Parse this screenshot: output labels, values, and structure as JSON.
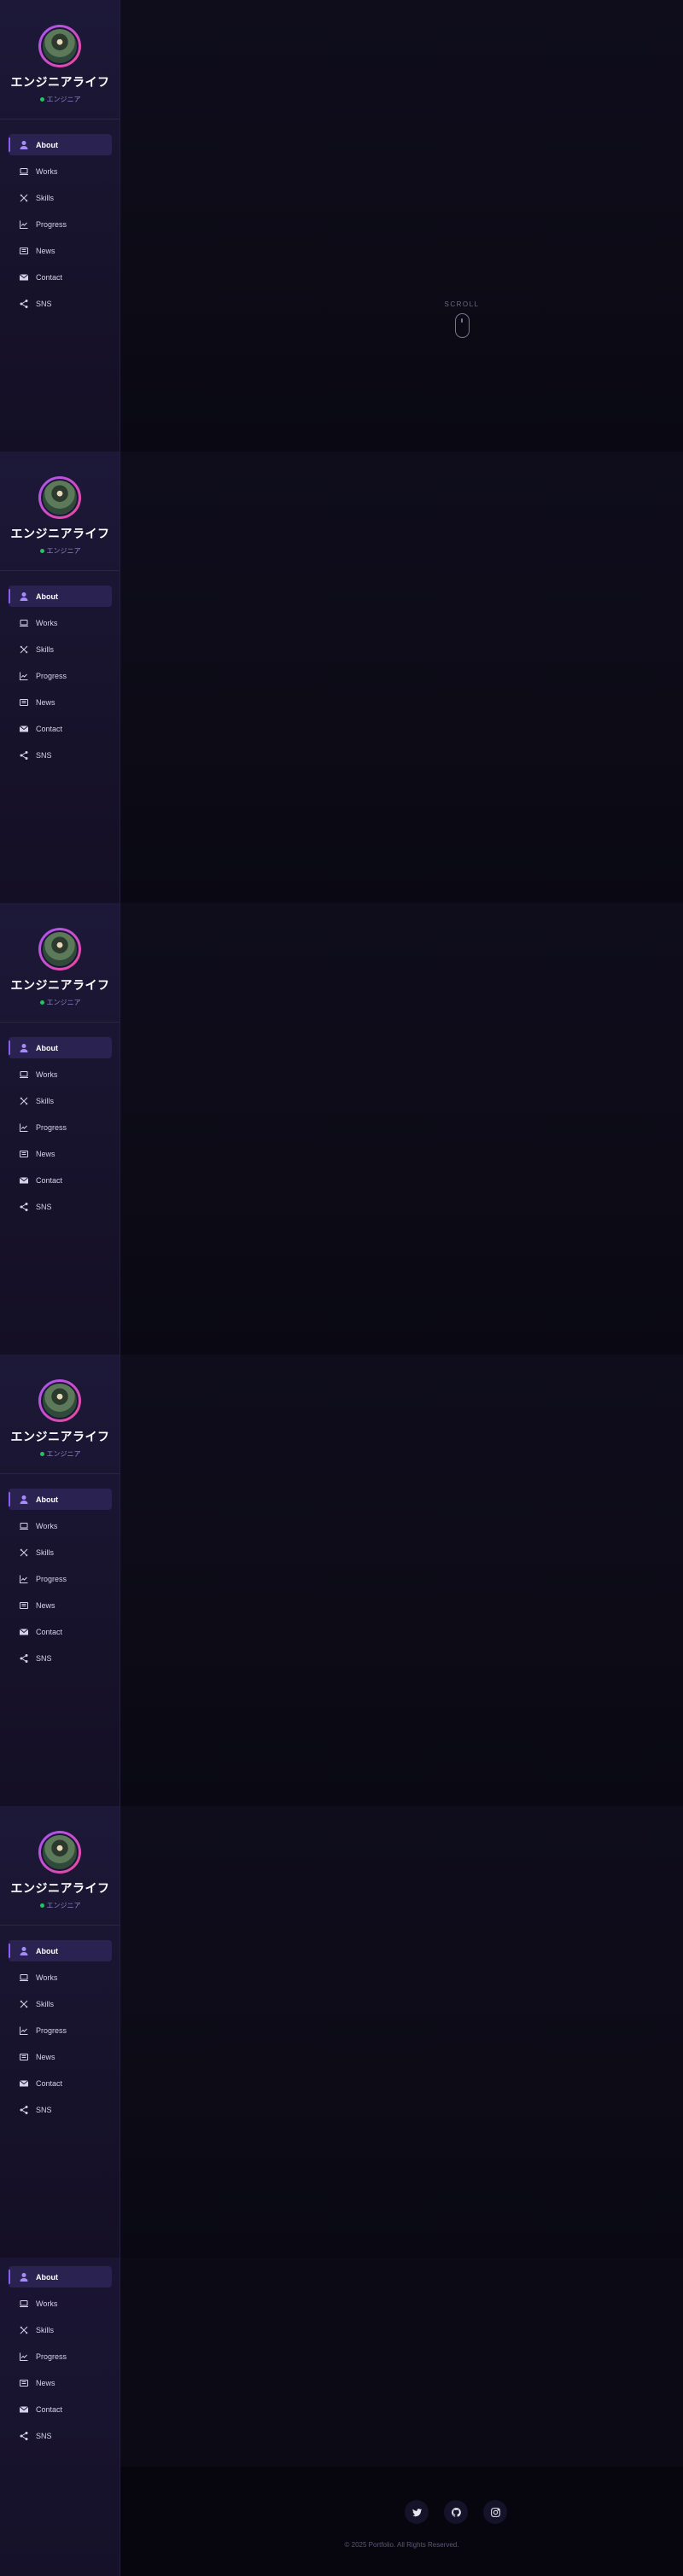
{
  "profile": {
    "name": "エンジニアライフ",
    "role": "エンジニア"
  },
  "nav": {
    "items": [
      {
        "label": "About",
        "icon": "user-icon",
        "active": true
      },
      {
        "label": "Works",
        "icon": "laptop-icon",
        "active": false
      },
      {
        "label": "Skills",
        "icon": "tools-icon",
        "active": false
      },
      {
        "label": "Progress",
        "icon": "chart-line-icon",
        "active": false
      },
      {
        "label": "News",
        "icon": "newspaper-icon",
        "active": false
      },
      {
        "label": "Contact",
        "icon": "envelope-icon",
        "active": false
      },
      {
        "label": "SNS",
        "icon": "share-icon",
        "active": false
      }
    ]
  },
  "hero": {
    "scroll_label": "SCROLL"
  },
  "footer": {
    "social": [
      "twitter-icon",
      "github-icon",
      "instagram-icon"
    ],
    "copyright": "© 2025 Portfolio. All Rights Reserved."
  },
  "colors": {
    "accent": "#8b5cf6",
    "status_dot": "#22c55e",
    "sidebar_bg": "#1d1838",
    "main_bg": "#0b0a14"
  }
}
